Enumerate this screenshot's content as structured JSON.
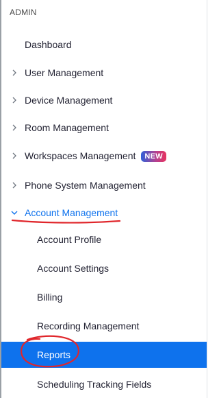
{
  "sidebar": {
    "section_label": "ADMIN",
    "items": [
      {
        "label": "Dashboard"
      },
      {
        "label": "User Management"
      },
      {
        "label": "Device Management"
      },
      {
        "label": "Room Management"
      },
      {
        "label": "Workspaces Management",
        "badge": "NEW"
      },
      {
        "label": "Phone System Management"
      },
      {
        "label": "Account Management"
      }
    ],
    "account_management_subitems": [
      {
        "label": "Account Profile"
      },
      {
        "label": "Account Settings"
      },
      {
        "label": "Billing"
      },
      {
        "label": "Recording Management"
      },
      {
        "label": "Reports"
      },
      {
        "label": "Scheduling Tracking Fields"
      }
    ]
  },
  "colors": {
    "accent": "#0e72ed",
    "text": "#232333",
    "annotation": "#e0262b"
  },
  "icons": {
    "collapsed": "chevron-right-icon",
    "expanded": "chevron-down-icon"
  }
}
